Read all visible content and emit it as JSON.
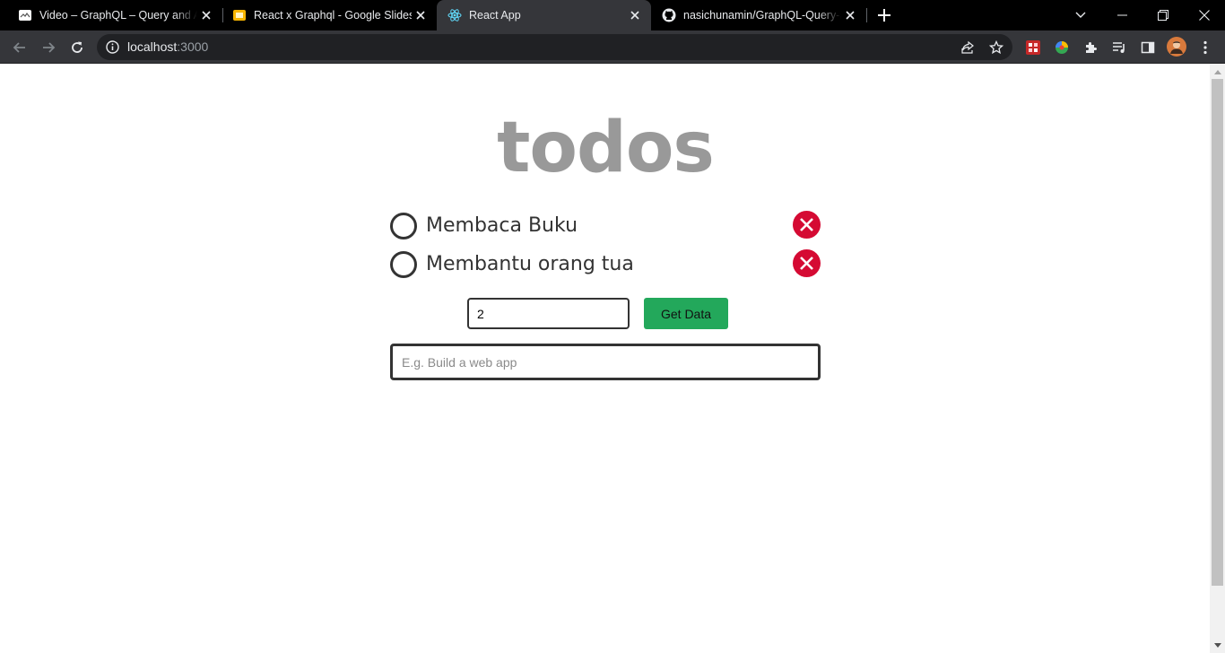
{
  "browser": {
    "tabs": [
      {
        "title": "Video – GraphQL – Query and Ap",
        "icon": "video-favicon-icon",
        "active": false
      },
      {
        "title": "React x Graphql - Google Slides",
        "icon": "google-slides-icon",
        "active": false
      },
      {
        "title": "React App",
        "icon": "react-icon",
        "active": true
      },
      {
        "title": "nasichunamin/GraphQL-Query-a",
        "icon": "github-icon",
        "active": false
      }
    ],
    "address": {
      "host": "localhost",
      "port": ":3000"
    }
  },
  "page": {
    "heading": "todos",
    "todos": [
      {
        "text": "Membaca Buku",
        "completed": false
      },
      {
        "text": "Membantu orang tua",
        "completed": false
      }
    ],
    "fetch": {
      "input_value": "2",
      "button_label": "Get Data"
    },
    "new_todo": {
      "placeholder": "E.g. Build a web app",
      "value": ""
    }
  },
  "colors": {
    "accent_red": "#d50a33",
    "button_green": "#23a85b",
    "heading_gray": "#999999"
  }
}
